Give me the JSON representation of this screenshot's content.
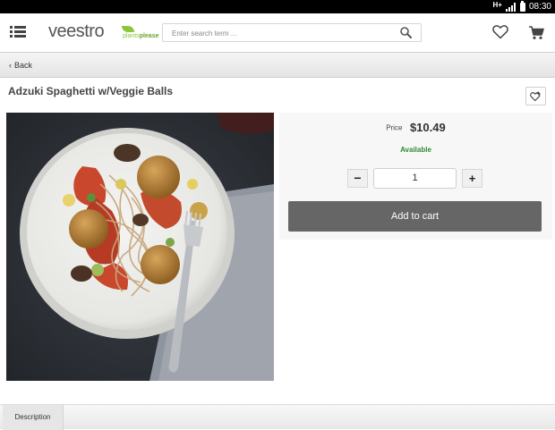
{
  "status_bar": {
    "network": "H+",
    "time": "08:30",
    "icons": [
      "signal-icon",
      "battery-icon"
    ]
  },
  "header": {
    "logo_text": "veestro",
    "logo_tagline_part1": "plants",
    "logo_tagline_part2": "please",
    "search_placeholder": "Enter search term ...",
    "icons": [
      "menu-icon",
      "search-icon",
      "heart-icon",
      "cart-icon"
    ]
  },
  "nav": {
    "back_label": "Back",
    "back_chevron": "‹"
  },
  "product": {
    "title": "Adzuki Spaghetti w/Veggie Balls",
    "price_label": "Price",
    "price": "$10.49",
    "availability": "Available",
    "quantity": "1",
    "minus_label": "−",
    "plus_label": "+",
    "add_to_cart_label": "Add to cart"
  },
  "tabs": {
    "description_label": "Description"
  },
  "colors": {
    "brand_green": "#8cc63f",
    "available_green": "#2e8b2e",
    "button_gray": "#666666"
  }
}
